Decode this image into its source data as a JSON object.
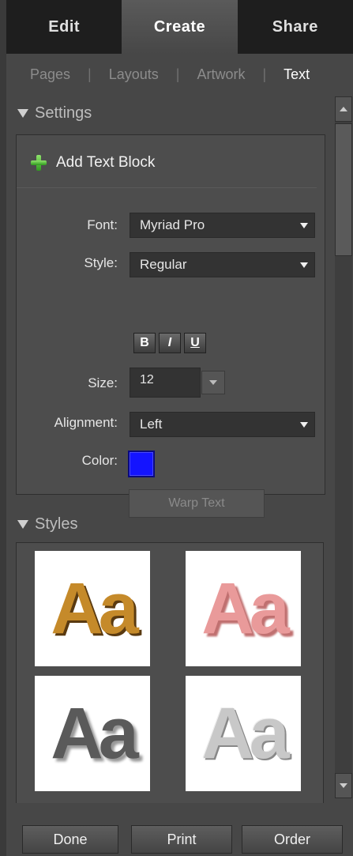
{
  "top_tabs": [
    {
      "label": "Edit"
    },
    {
      "label": "Create"
    },
    {
      "label": "Share"
    }
  ],
  "sub_tabs": [
    {
      "label": "Pages"
    },
    {
      "label": "Layouts"
    },
    {
      "label": "Artwork"
    },
    {
      "label": "Text"
    }
  ],
  "settings": {
    "header": "Settings",
    "add_text_block": "Add Text Block",
    "font_label": "Font:",
    "font_value": "Myriad Pro",
    "style_label": "Style:",
    "style_value": "Regular",
    "bold": "B",
    "italic": "I",
    "underline": "U",
    "size_label": "Size:",
    "size_value": "12",
    "alignment_label": "Alignment:",
    "alignment_value": "Left",
    "color_label": "Color:",
    "color_value": "#1414ff",
    "warp_text": "Warp Text"
  },
  "styles": {
    "header": "Styles",
    "thumbnails": [
      {
        "text": "Aa",
        "icon": "leopard-texture"
      },
      {
        "text": "Aa",
        "icon": "pink-texture"
      },
      {
        "text": "Aa",
        "icon": "zebra-texture"
      },
      {
        "text": "Aa",
        "icon": "chrome-bevel"
      }
    ]
  },
  "bottom": {
    "done": "Done",
    "print": "Print",
    "order": "Order"
  }
}
